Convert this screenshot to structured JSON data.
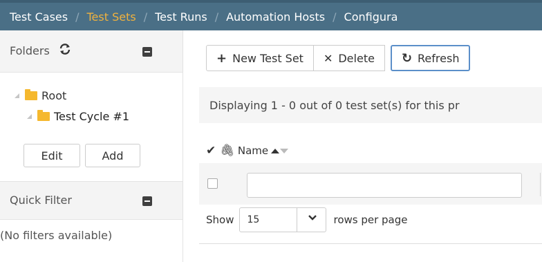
{
  "topnav": {
    "items": [
      {
        "label": "Test Cases",
        "active": false
      },
      {
        "label": "Test Sets",
        "active": true
      },
      {
        "label": "Test Runs",
        "active": false
      },
      {
        "label": "Automation Hosts",
        "active": false
      },
      {
        "label": "Configura",
        "active": false
      }
    ],
    "separator": "/"
  },
  "folders_panel": {
    "title": "Folders",
    "refresh_icon": "refresh-icon",
    "minimize_icon": "minimize-icon",
    "tree": [
      {
        "label": "Root",
        "level": 0
      },
      {
        "label": "Test Cycle #1",
        "level": 1,
        "selected": true
      }
    ],
    "edit_label": "Edit",
    "add_label": "Add"
  },
  "quick_filter": {
    "title": "Quick Filter",
    "empty_text": "(No filters available)"
  },
  "toolbar": {
    "new_label": "New Test Set",
    "new_icon": "+",
    "delete_label": "Delete",
    "delete_icon": "✕",
    "refresh_label": "Refresh",
    "refresh_icon": "↻"
  },
  "info_text": "Displaying 1 - 0 out of 0 test set(s) for this pr",
  "grid": {
    "name_header": "Name",
    "name_filter_value": ""
  },
  "pager": {
    "show_label": "Show",
    "page_size": "15",
    "rows_label": "rows per page"
  },
  "colors": {
    "nav_bg": "#4a6f86",
    "nav_active": "#f0b23e",
    "folder": "#f5b82e",
    "refresh_border": "#5b8fc9"
  }
}
